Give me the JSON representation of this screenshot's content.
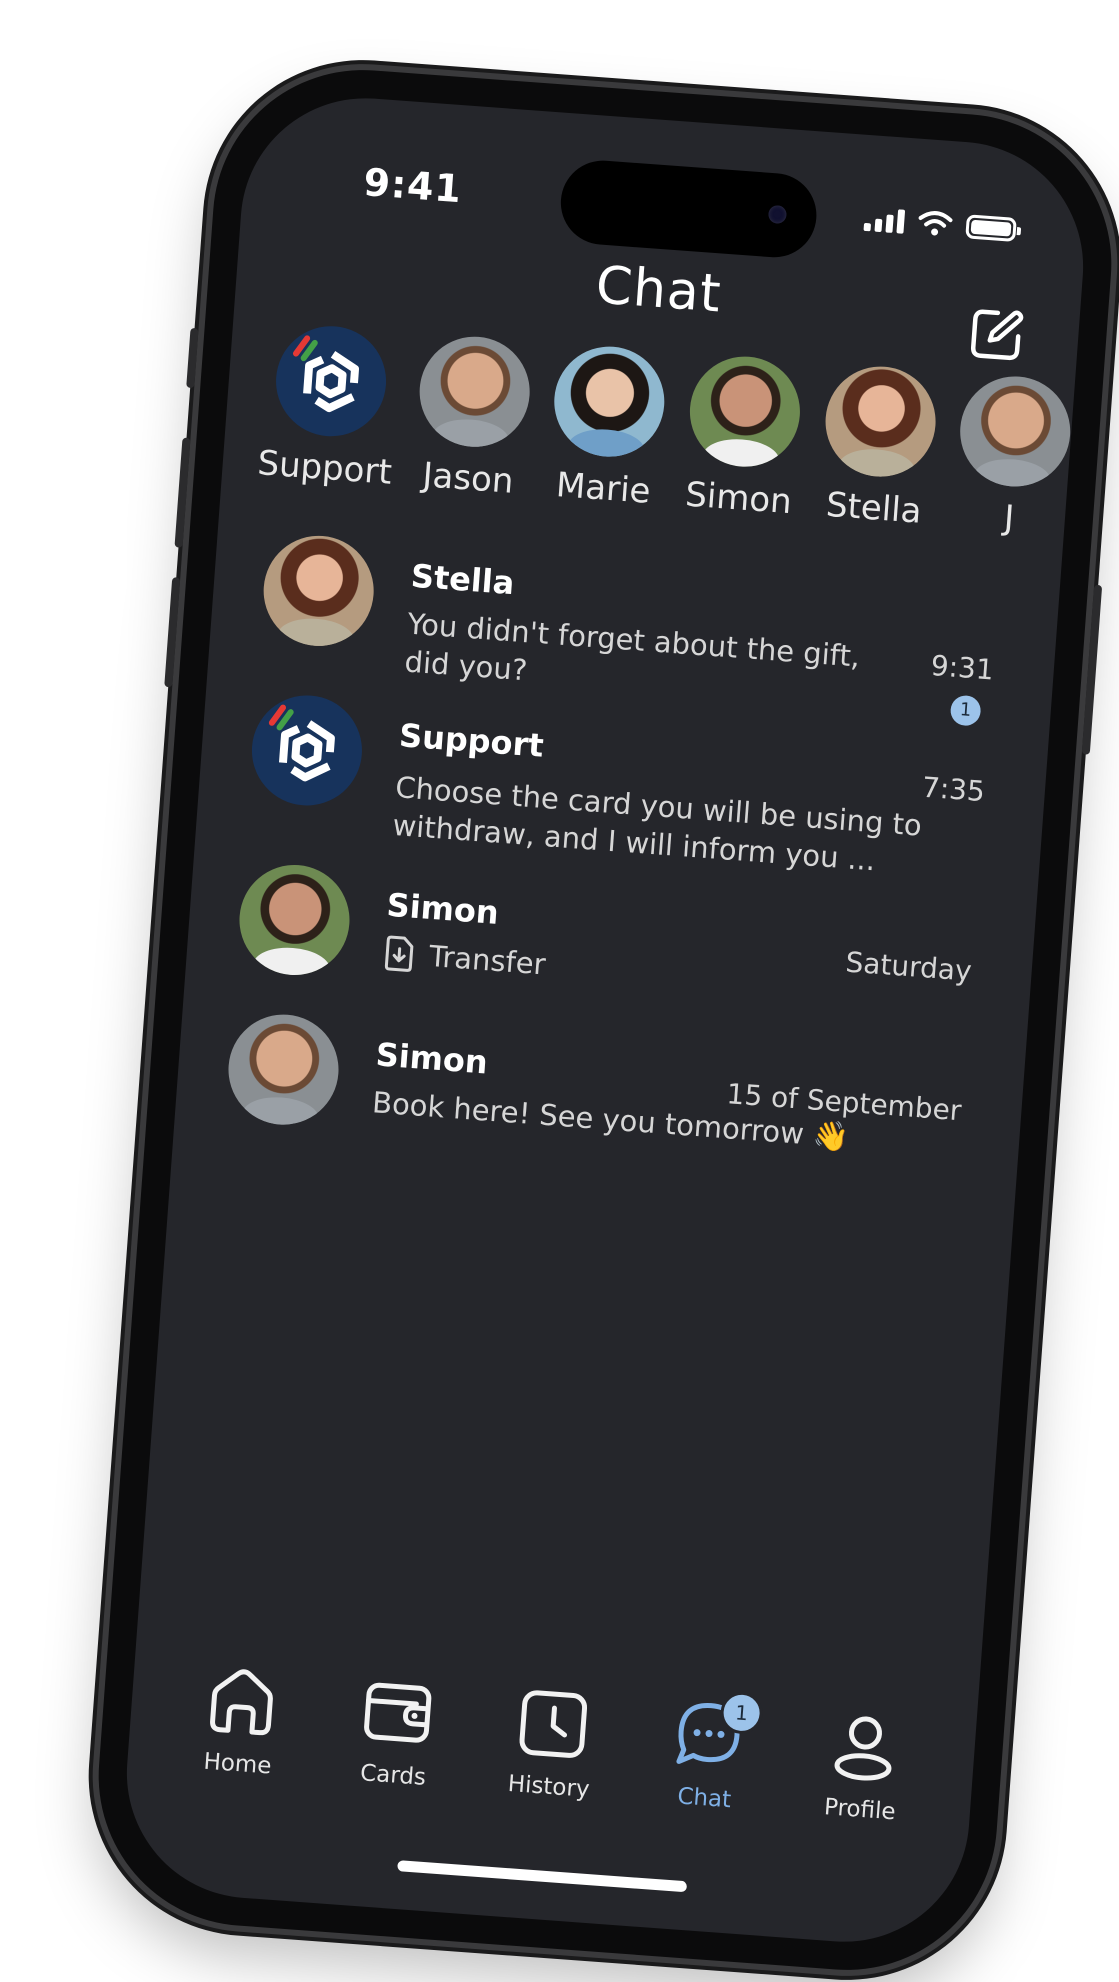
{
  "status_bar": {
    "time": "9:41"
  },
  "header": {
    "title": "Chat"
  },
  "stories": [
    {
      "name": "Support",
      "avatar": "support"
    },
    {
      "name": "Jason",
      "avatar": "jason"
    },
    {
      "name": "Marie",
      "avatar": "marie"
    },
    {
      "name": "Simon",
      "avatar": "simon"
    },
    {
      "name": "Stella",
      "avatar": "stella"
    },
    {
      "name": "J",
      "avatar": "jason"
    }
  ],
  "chats": [
    {
      "name": "Stella",
      "message": "You didn't forget about the gift, did you?",
      "time": "9:31",
      "unread": "1"
    },
    {
      "name": "Support",
      "message": "Choose the card you will be using to withdraw, and I will inform you ...",
      "time": "7:35"
    },
    {
      "name": "Simon",
      "message": "Transfer",
      "time": "Saturday",
      "attachment_icon": "file-download-icon"
    },
    {
      "name": "Simon",
      "message": "Book here! See you tomorrow 👋",
      "time": "15 of September"
    }
  ],
  "tabs": [
    {
      "label": "Home",
      "icon": "home-icon"
    },
    {
      "label": "Cards",
      "icon": "wallet-icon"
    },
    {
      "label": "History",
      "icon": "clock-icon"
    },
    {
      "label": "Chat",
      "icon": "chat-bubble-icon",
      "active": true,
      "badge": "1"
    },
    {
      "label": "Profile",
      "icon": "user-icon"
    }
  ],
  "colors": {
    "background": "#25262b",
    "accent": "#7fb0e6",
    "badge": "#9cc3ea",
    "support_brand": "#17335c"
  }
}
